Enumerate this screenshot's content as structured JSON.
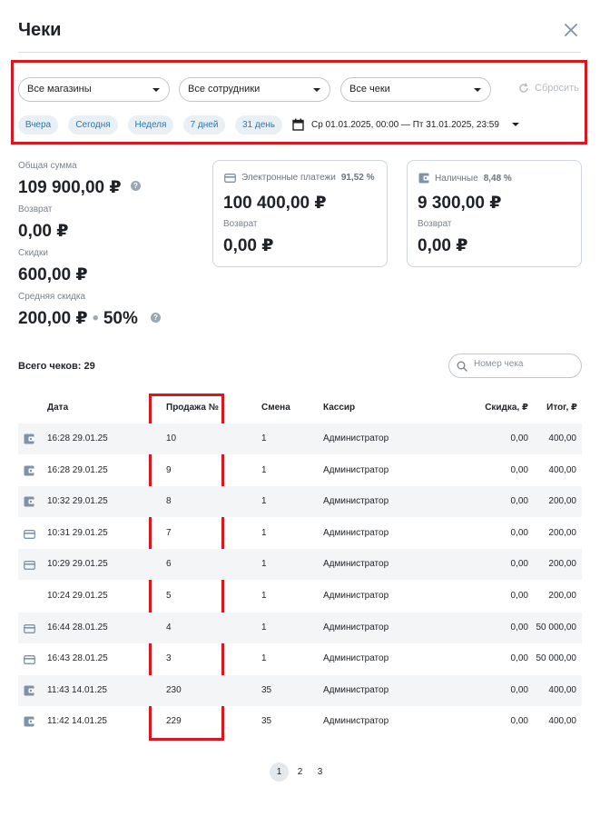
{
  "title": "Чеки",
  "filters": {
    "store": "Все магазины",
    "employee": "Все сотрудники",
    "receipts": "Все чеки",
    "reset": "Сбросить",
    "presets": [
      "Вчера",
      "Сегодня",
      "Неделя",
      "7 дней",
      "31 день"
    ],
    "date_range": "Ср 01.01.2025, 00:00 — Пт 31.01.2025, 23:59"
  },
  "summary": {
    "total_label": "Общая сумма",
    "total_value": "109 900,00 ₽",
    "refund_label": "Возврат",
    "refund_value": "0,00 ₽",
    "discounts_label": "Скидки",
    "discounts_value": "600,00 ₽",
    "avg_discount_label": "Средняя скидка",
    "avg_discount_value": "200,00 ₽",
    "avg_discount_percent": "50%",
    "help_glyph": "?"
  },
  "cards": [
    {
      "title": "Электронные платежи",
      "percent": "91,52 %",
      "value": "100 400,00 ₽",
      "refund_label": "Возврат",
      "refund_value": "0,00 ₽"
    },
    {
      "title": "Наличные",
      "percent": "8,48 %",
      "value": "9 300,00 ₽",
      "refund_label": "Возврат",
      "refund_value": "0,00 ₽"
    }
  ],
  "list": {
    "total_text": "Всего чеков: 29",
    "search_placeholder": "Номер чека"
  },
  "table": {
    "headers": {
      "date": "Дата",
      "sale": "Продажа №",
      "shift": "Смена",
      "cashier": "Кассир",
      "discount": "Скидка, ₽",
      "total": "Итог, ₽"
    },
    "rows": [
      {
        "icon": "cash-icon",
        "date": "16:28 29.01.25",
        "sale": "10",
        "shift": "1",
        "cashier": "Администратор",
        "discount": "0,00",
        "total": "400,00"
      },
      {
        "icon": "cash-icon",
        "date": "16:28 29.01.25",
        "sale": "9",
        "shift": "1",
        "cashier": "Администратор",
        "discount": "0,00",
        "total": "400,00"
      },
      {
        "icon": "cash-icon",
        "date": "10:32 29.01.25",
        "sale": "8",
        "shift": "1",
        "cashier": "Администратор",
        "discount": "0,00",
        "total": "200,00"
      },
      {
        "icon": "card-icon",
        "date": "10:31 29.01.25",
        "sale": "7",
        "shift": "1",
        "cashier": "Администратор",
        "discount": "0,00",
        "total": "200,00"
      },
      {
        "icon": "card-icon",
        "date": "10:29 29.01.25",
        "sale": "6",
        "shift": "1",
        "cashier": "Администратор",
        "discount": "0,00",
        "total": "200,00"
      },
      {
        "icon": "none",
        "date": "10:24 29.01.25",
        "sale": "5",
        "shift": "1",
        "cashier": "Администратор",
        "discount": "0,00",
        "total": "200,00"
      },
      {
        "icon": "card-icon",
        "date": "16:44 28.01.25",
        "sale": "4",
        "shift": "1",
        "cashier": "Администратор",
        "discount": "0,00",
        "total": "50 000,00"
      },
      {
        "icon": "card-icon",
        "date": "16:43 28.01.25",
        "sale": "3",
        "shift": "1",
        "cashier": "Администратор",
        "discount": "0,00",
        "total": "50 000,00"
      },
      {
        "icon": "cash-icon",
        "date": "11:43 14.01.25",
        "sale": "230",
        "shift": "35",
        "cashier": "Администратор",
        "discount": "0,00",
        "total": "400,00"
      },
      {
        "icon": "cash-icon",
        "date": "11:42 14.01.25",
        "sale": "229",
        "shift": "35",
        "cashier": "Администратор",
        "discount": "0,00",
        "total": "400,00"
      }
    ]
  },
  "pagination": {
    "pages": [
      "1",
      "2",
      "3"
    ],
    "current": "1"
  },
  "colors": {
    "accent": "#2478b8",
    "highlight": "#e0141b",
    "icon": "#7d94a8"
  }
}
